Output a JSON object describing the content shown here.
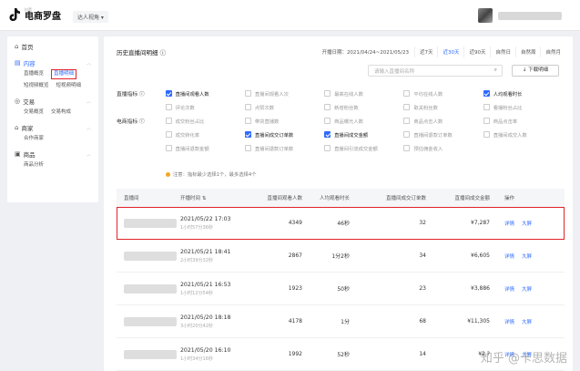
{
  "topbar": {
    "logo_sub": "抖音",
    "logo_main": "电商罗盘",
    "role": "达人视角 ▾"
  },
  "sidebar": {
    "groups": [
      {
        "label": "首页",
        "icon": "home-icon",
        "glyph": "⌂",
        "items": []
      },
      {
        "label": "内容",
        "icon": "content-icon",
        "glyph": "▤",
        "items": [
          "直播概览",
          "直播明细",
          "短视频概览",
          "短视频明细"
        ]
      },
      {
        "label": "交易",
        "icon": "trade-icon",
        "glyph": "◎",
        "items": [
          "交易概览",
          "交易构成"
        ]
      },
      {
        "label": "商家",
        "icon": "merchant-icon",
        "glyph": "⌂",
        "items": [
          "合作商家"
        ]
      },
      {
        "label": "商品",
        "icon": "product-icon",
        "glyph": "▣",
        "items": [
          "商品分析"
        ]
      }
    ],
    "highlight_item": "直播明细"
  },
  "main": {
    "title": "历史直播间明细 ⓘ",
    "date_label": "开播日期：2021/04/24~2021/05/23",
    "date_buttons": [
      "近7天",
      "近30天",
      "近90天",
      "自然日",
      "自然周",
      "自然月"
    ],
    "date_active": "近30天",
    "search_placeholder": "请输入直播间名称",
    "download_label": "↓ 下载明细",
    "metric_groups": [
      {
        "label": "直播指标 ⓘ",
        "rows": [
          [
            [
              "直播间观看人数",
              true
            ],
            [
              "直播间观看人次",
              false
            ],
            [
              "最高在线人数",
              false
            ],
            [
              "平均在线人数",
              false
            ],
            [
              "人均观看时长",
              true
            ]
          ],
          [
            [
              "评论次数",
              false
            ],
            [
              "点赞次数",
              false
            ],
            [
              "新增粉丝数",
              false
            ],
            [
              "取关粉丝数",
              false
            ],
            [
              "看播粉丝占比",
              false
            ]
          ]
        ]
      },
      {
        "label": "电商指标 ⓘ",
        "rows": [
          [
            [
              "成交粉丝占比",
              false
            ],
            [
              "带货直播数",
              false
            ],
            [
              "商品曝光人数",
              false
            ],
            [
              "商品点击人数",
              false
            ],
            [
              "商品点击率",
              false
            ]
          ],
          [
            [
              "成交转化率",
              false
            ],
            [
              "直播间成交订单数",
              true
            ],
            [
              "直播间成交金额",
              true
            ],
            [
              "直播间退款订单数",
              false
            ],
            [
              "直播间成交人数",
              false
            ]
          ],
          [
            [
              "直播间退款金额",
              false
            ],
            [
              "直播间退款订单数",
              false
            ],
            [
              "直播间引流成交金额",
              false
            ],
            [
              "预估佣金收入",
              false
            ],
            [
              "",
              false
            ]
          ]
        ]
      }
    ],
    "note": "注意：指标最少选择1个，最多选择4个"
  },
  "table": {
    "headers": [
      "直播间",
      "开播时间 ⇅",
      "直播间观看人数",
      "人均观看时长",
      "直播间成交订单数",
      "直播间成交金额",
      "操作"
    ],
    "rows": [
      {
        "time": "2021/05/22 17:03",
        "duration": "1小时57分36秒",
        "viewers": "4349",
        "avg": "46秒",
        "orders": "32",
        "amount": "¥7,287"
      },
      {
        "time": "2021/05/21 18:41",
        "duration": "2小时39分32秒",
        "viewers": "2867",
        "avg": "1分2秒",
        "orders": "34",
        "amount": "¥6,605"
      },
      {
        "time": "2021/05/21 16:53",
        "duration": "1小时12分54秒",
        "viewers": "1923",
        "avg": "50秒",
        "orders": "23",
        "amount": "¥3,886"
      },
      {
        "time": "2021/05/20 18:18",
        "duration": "3小时20分42秒",
        "viewers": "4178",
        "avg": "1分",
        "orders": "68",
        "amount": "¥11,305"
      },
      {
        "time": "2021/05/20 16:10",
        "duration": "1小时34分16秒",
        "viewers": "1992",
        "avg": "52秒",
        "orders": "14",
        "amount": "¥2,?"
      }
    ],
    "op_detail": "详情",
    "op_screen": "大屏"
  },
  "watermark": "知乎 @卡思数据",
  "colors": {
    "accent": "#2f6bff",
    "highlight": "#e0242b"
  }
}
